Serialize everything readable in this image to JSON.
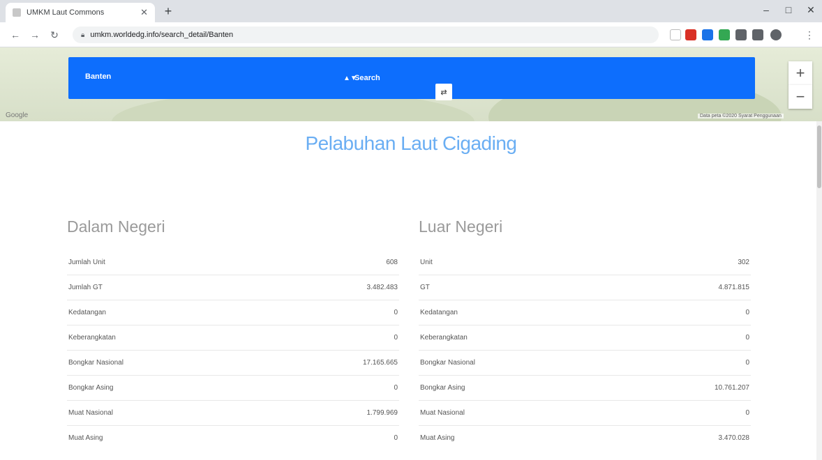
{
  "browser": {
    "tab_title": "UMKM Laut Commons",
    "new_tab_glyph": "+",
    "window_controls": [
      "–",
      "□",
      "✕"
    ],
    "url": "umkm.worldedg.info/search_detail/Banten",
    "extension_colors": [
      "#d93025",
      "#1a73e8",
      "#34a853",
      "#5f6368",
      "#5f6368",
      "#5f6368"
    ]
  },
  "map": {
    "logo": "Google",
    "attribution": "Data peta ©2020   Syarat Penggunaan",
    "zoom_in": "+",
    "zoom_out": "−"
  },
  "search": {
    "province_label": "Banten",
    "province_arrow": "▲▼",
    "search_label": "Search",
    "search_button_icon": "⇄"
  },
  "page": {
    "title": "Pelabuhan Laut Cigading"
  },
  "dalam_negeri": {
    "heading": "Dalam Negeri",
    "rows": [
      {
        "label": "Jumlah Unit",
        "value": "608"
      },
      {
        "label": "Jumlah GT",
        "value": "3.482.483"
      },
      {
        "label": "Kedatangan",
        "value": "0"
      },
      {
        "label": "Keberangkatan",
        "value": "0"
      },
      {
        "label": "Bongkar Nasional",
        "value": "17.165.665"
      },
      {
        "label": "Bongkar Asing",
        "value": "0"
      },
      {
        "label": "Muat Nasional",
        "value": "1.799.969"
      },
      {
        "label": "Muat Asing",
        "value": "0"
      }
    ]
  },
  "luar_negeri": {
    "heading": "Luar Negeri",
    "rows": [
      {
        "label": "Unit",
        "value": "302"
      },
      {
        "label": "GT",
        "value": "4.871.815"
      },
      {
        "label": "Kedatangan",
        "value": "0"
      },
      {
        "label": "Keberangkatan",
        "value": "0"
      },
      {
        "label": "Bongkar Nasional",
        "value": "0"
      },
      {
        "label": "Bongkar Asing",
        "value": "10.761.207"
      },
      {
        "label": "Muat Nasional",
        "value": "0"
      },
      {
        "label": "Muat Asing",
        "value": "3.470.028"
      }
    ]
  }
}
